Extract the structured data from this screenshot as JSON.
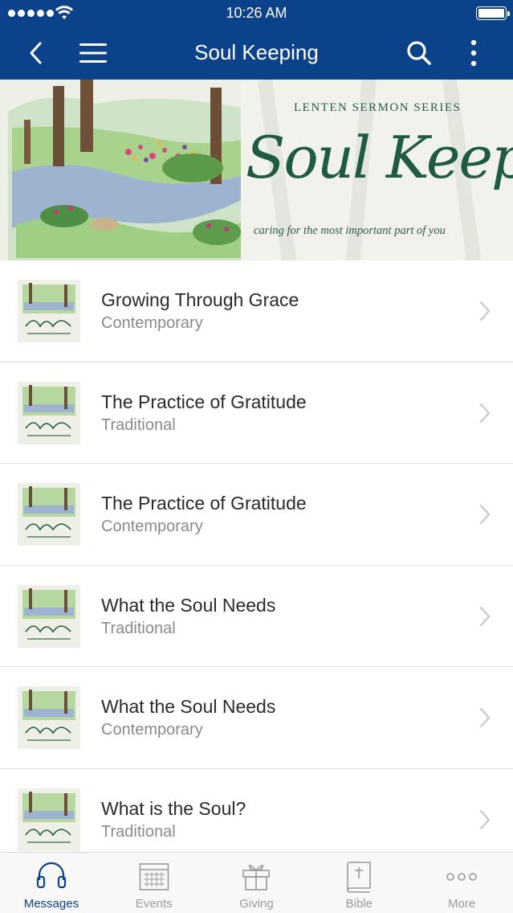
{
  "status": {
    "time": "10:26 AM"
  },
  "nav": {
    "title": "Soul Keeping"
  },
  "banner": {
    "kicker": "LENTEN SERMON SERIES",
    "title": "Soul Keeping",
    "subtitle": "caring for the most important part of you"
  },
  "messages": [
    {
      "title": "Growing Through Grace",
      "subtitle": "Contemporary"
    },
    {
      "title": "The Practice of Gratitude",
      "subtitle": "Traditional"
    },
    {
      "title": "The Practice of Gratitude",
      "subtitle": "Contemporary"
    },
    {
      "title": "What the Soul Needs",
      "subtitle": "Traditional"
    },
    {
      "title": "What the Soul Needs",
      "subtitle": "Contemporary"
    },
    {
      "title": "What is the Soul?",
      "subtitle": "Traditional"
    }
  ],
  "tabs": [
    {
      "label": "Messages",
      "icon": "headphones-icon",
      "active": true
    },
    {
      "label": "Events",
      "icon": "calendar-icon",
      "active": false
    },
    {
      "label": "Giving",
      "icon": "gift-icon",
      "active": false
    },
    {
      "label": "Bible",
      "icon": "bible-icon",
      "active": false
    },
    {
      "label": "More",
      "icon": "more-dots-icon",
      "active": false
    }
  ],
  "colors": {
    "nav_background": "#0b4289",
    "active_tab": "#0b4289",
    "inactive_tab": "#9a9a9a",
    "banner_script": "#1f5b3e"
  }
}
